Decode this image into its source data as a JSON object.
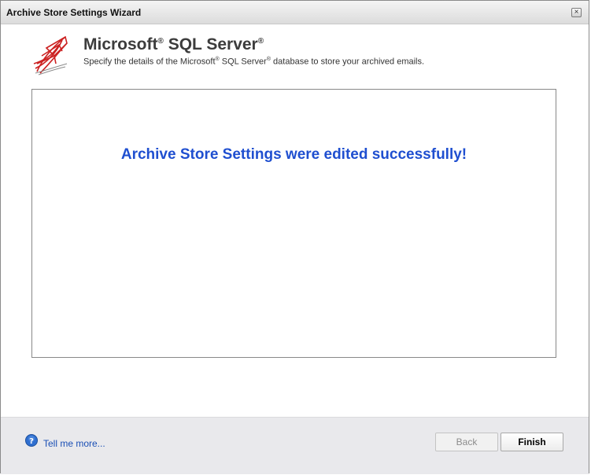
{
  "window": {
    "title": "Archive Store Settings Wizard",
    "close_glyph": "×"
  },
  "header": {
    "product_name": "Microsoft",
    "product_reg": "®",
    "product_suffix": "SQL Server",
    "product_suffix_reg": "®",
    "subtitle_part1": "Specify the details of the Microsoft",
    "subtitle_reg1": "®",
    "subtitle_part2": " SQL Server",
    "subtitle_reg2": "®",
    "subtitle_part3": " database to store your archived emails.",
    "logo_icon": "sql-server-logo-icon"
  },
  "content": {
    "message": "Archive Store Settings were edited successfully!"
  },
  "footer": {
    "help_link": "Tell me more...",
    "help_icon": "question-circle-icon",
    "back_label": "Back",
    "finish_label": "Finish"
  },
  "colors": {
    "message": "#1f4fd0",
    "link": "#1a4fb5",
    "footer_bg": "#e9e9ec",
    "logo_red": "#cc2222"
  }
}
